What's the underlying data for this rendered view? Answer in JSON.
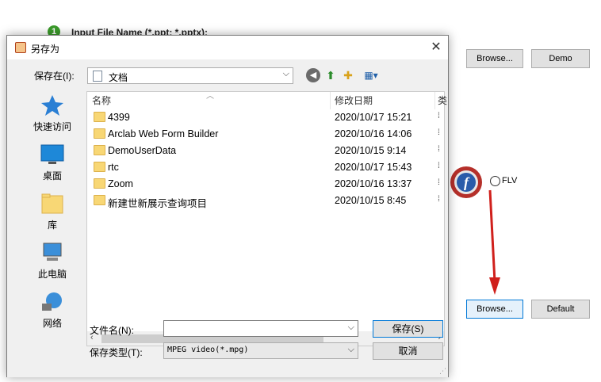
{
  "background": {
    "step_title": "Input File Name (*.ppt; *.pptx):",
    "buttons": {
      "browse_top": "Browse...",
      "demo": "Demo",
      "browse_bottom": "Browse...",
      "default": "Default"
    },
    "radio_flv_label": "FLV"
  },
  "dialog": {
    "title": "另存为",
    "save_in_label": "保存在(I):",
    "save_in_value": "文档",
    "places": [
      {
        "label": "快速访问",
        "icon": "star-icon"
      },
      {
        "label": "桌面",
        "icon": "desktop-icon"
      },
      {
        "label": "库",
        "icon": "library-icon"
      },
      {
        "label": "此电脑",
        "icon": "computer-icon"
      },
      {
        "label": "网络",
        "icon": "network-icon"
      }
    ],
    "columns": {
      "name": "名称",
      "modified": "修改日期",
      "third": "类"
    },
    "files": [
      {
        "name": "4399",
        "date": "2020/10/17 15:21"
      },
      {
        "name": "Arclab Web Form Builder",
        "date": "2020/10/16 14:06"
      },
      {
        "name": "DemoUserData",
        "date": "2020/10/15 9:14"
      },
      {
        "name": "rtc",
        "date": "2020/10/17 15:43"
      },
      {
        "name": "Zoom",
        "date": "2020/10/16 13:37"
      },
      {
        "name": "新建世新展示查询项目",
        "date": "2020/10/15 8:45"
      }
    ],
    "filename_label": "文件名(N):",
    "filename_value": "",
    "filetype_label": "保存类型(T):",
    "filetype_value": "MPEG video(*.mpg)",
    "save_button": "保存(S)",
    "cancel_button": "取消"
  },
  "colors": {
    "accent": "#0078d7",
    "folder": "#f8d775",
    "arrow": "#d0201c"
  }
}
